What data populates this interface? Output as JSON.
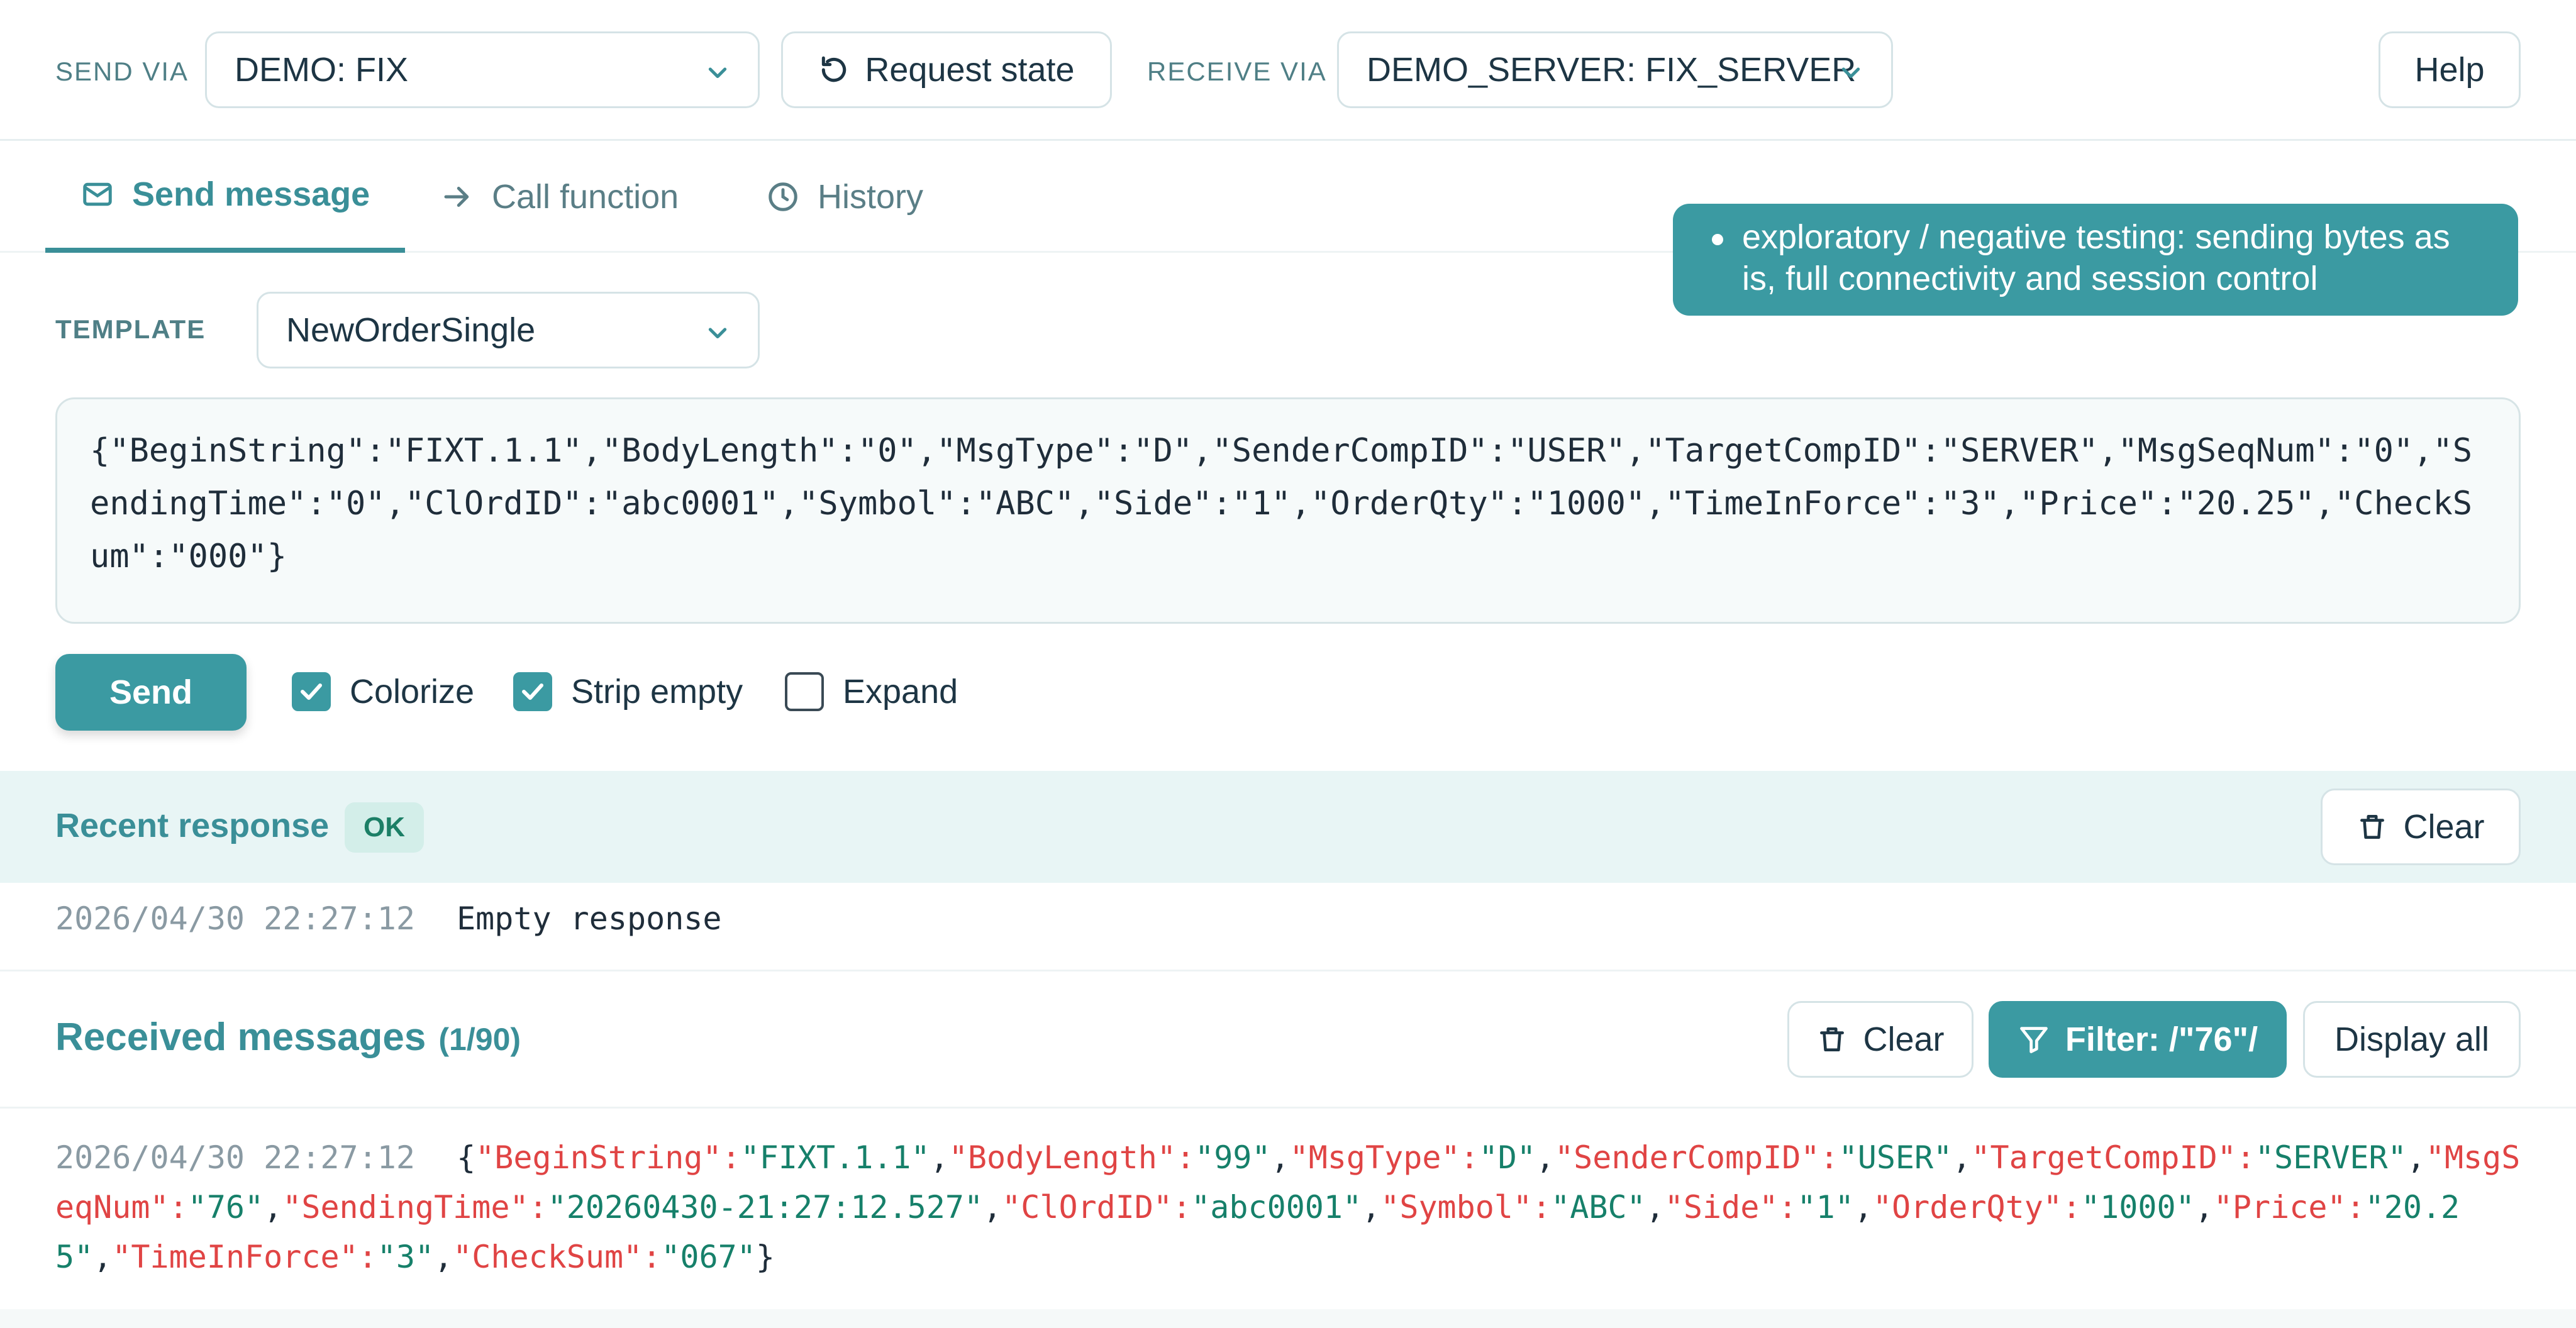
{
  "topbar": {
    "send_via_label": "SEND VIA",
    "send_via_value": "DEMO: FIX",
    "request_state_label": "Request state",
    "receive_via_label": "RECEIVE VIA",
    "receive_via_value": "DEMO_SERVER: FIX_SERVER",
    "help_label": "Help"
  },
  "tabs": [
    {
      "label": "Send message",
      "icon": "mail-icon",
      "active": true
    },
    {
      "label": "Call function",
      "icon": "arrow-right-icon",
      "active": false
    },
    {
      "label": "History",
      "icon": "clock-icon",
      "active": false
    }
  ],
  "tooltip": {
    "text": "exploratory / negative testing: sending bytes as is, full connectivity and session control"
  },
  "template": {
    "label": "TEMPLATE",
    "value": "NewOrderSingle"
  },
  "editor": {
    "value": "{\"BeginString\":\"FIXT.1.1\",\"BodyLength\":\"0\",\"MsgType\":\"D\",\"SenderCompID\":\"USER\",\"TargetCompID\":\"SERVER\",\"MsgSeqNum\":\"0\",\"SendingTime\":\"0\",\"ClOrdID\":\"abc0001\",\"Symbol\":\"ABC\",\"Side\":\"1\",\"OrderQty\":\"1000\",\"TimeInForce\":\"3\",\"Price\":\"20.25\",\"CheckSum\":\"000\"}"
  },
  "actions": {
    "send_label": "Send",
    "colorize_label": "Colorize",
    "colorize_checked": true,
    "strip_empty_label": "Strip empty",
    "strip_empty_checked": true,
    "expand_label": "Expand",
    "expand_checked": false
  },
  "recent_response": {
    "title": "Recent response",
    "status": "OK",
    "clear_label": "Clear",
    "timestamp": "2026/04/30 22:27:12",
    "text": "Empty response"
  },
  "received": {
    "title": "Received messages",
    "count": "(1/90)",
    "clear_label": "Clear",
    "filter_label": "Filter: /\"76\"/",
    "display_all_label": "Display all",
    "messages": [
      {
        "timestamp": "2026/04/30 22:27:12",
        "fields": [
          {
            "k": "BeginString",
            "v": "FIXT.1.1"
          },
          {
            "k": "BodyLength",
            "v": "99"
          },
          {
            "k": "MsgType",
            "v": "D"
          },
          {
            "k": "SenderCompID",
            "v": "USER"
          },
          {
            "k": "TargetCompID",
            "v": "SERVER"
          },
          {
            "k": "MsgSeqNum",
            "v": "76"
          },
          {
            "k": "SendingTime",
            "v": "20260430-21:27:12.527"
          },
          {
            "k": "ClOrdID",
            "v": "abc0001"
          },
          {
            "k": "Symbol",
            "v": "ABC"
          },
          {
            "k": "Side",
            "v": "1"
          },
          {
            "k": "OrderQty",
            "v": "1000"
          },
          {
            "k": "Price",
            "v": "20.25"
          },
          {
            "k": "TimeInForce",
            "v": "3"
          },
          {
            "k": "CheckSum",
            "v": "067"
          }
        ]
      }
    ]
  },
  "colors": {
    "accent": "#3b9aa2",
    "key": "#e04444",
    "value": "#16806a",
    "ok_badge_bg": "#d3eee9"
  }
}
